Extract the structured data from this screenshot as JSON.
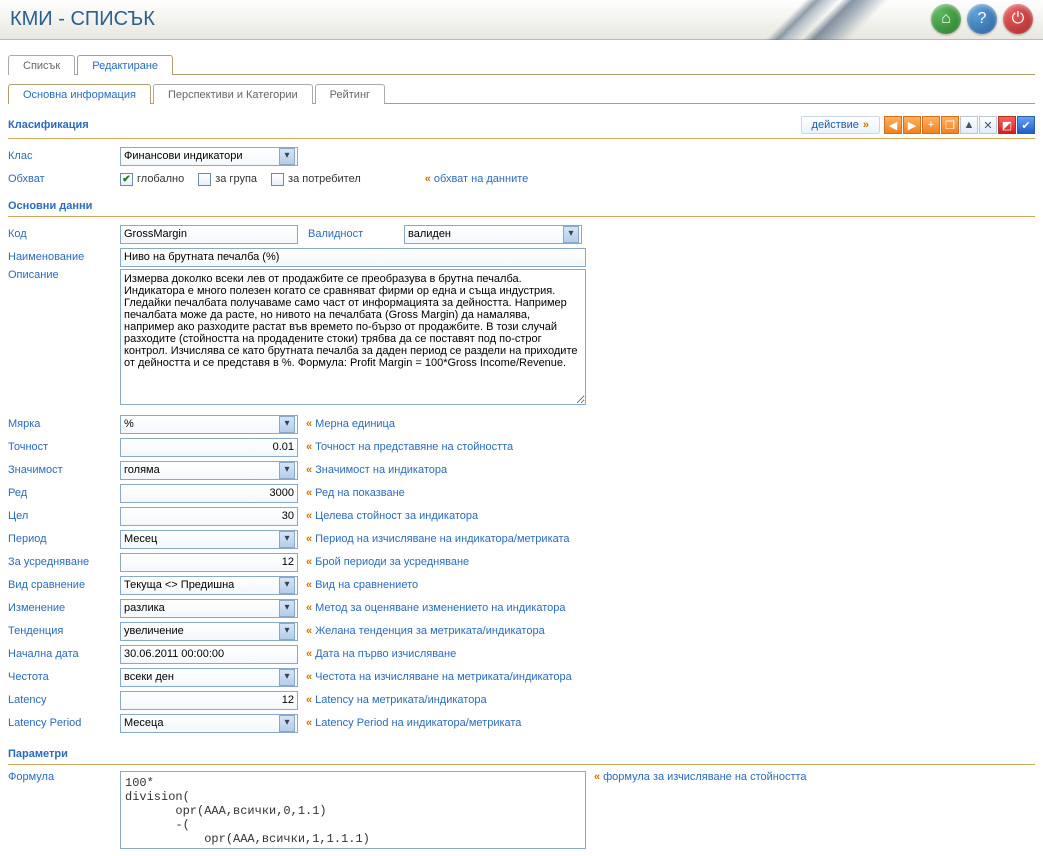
{
  "header": {
    "title": "КМИ - СПИСЪК"
  },
  "tabs": {
    "list": "Списък",
    "edit": "Редактиране"
  },
  "subtabs": {
    "basic": "Основна информация",
    "persp": "Перспективи и Категории",
    "rating": "Рейтинг"
  },
  "action_label": "действие",
  "sections": {
    "classification": "Класификация",
    "basicdata": "Основни данни",
    "parameters": "Параметри"
  },
  "labels": {
    "class": "Клас",
    "scope": "Обхват",
    "global": "глобално",
    "group": "за група",
    "user": "за потребител",
    "scope_hint": "обхват на данните",
    "code": "Код",
    "validity": "Валидност",
    "name": "Наименование",
    "desc": "Описание",
    "measure": "Мярка",
    "precision": "Точност",
    "significance": "Значимост",
    "order": "Ред",
    "target": "Цел",
    "period": "Период",
    "averaging": "За усредняване",
    "compare": "Вид сравнение",
    "change": "Изменение",
    "trend": "Тенденция",
    "startdate": "Начална дата",
    "freq": "Честота",
    "latency": "Latency",
    "latperiod": "Latency Period",
    "formula": "Формула"
  },
  "values": {
    "class": "Финансови индикатори",
    "code": "GrossMargin",
    "validity": "валиден",
    "name": "Ниво на брутната печалба (%)",
    "desc": "Измерва доколко всеки лев от продажбите се преобразува в брутна печалба. Индикатора е много полезен когато се сравняват фирми ор една и съща индустрия. Гледайки печалбата получаваме само част от информацията за дейността. Например печалбата може да расте, но нивото на печалбата (Gross Margin) да намалява, например ако разходите растат във времето по-бързо от продажбите. В този случай разходите (стойността на продадените стоки) трябва да се поставят под по-строг контрол. Изчислява се като брутната печалба за даден период се раздели на приходите от дейността и се представя в %. Формула: Profit Margin = 100*Gross Income/Revenue.",
    "measure": "%",
    "precision": "0.01",
    "significance": "голяма",
    "order": "3000",
    "target": "30",
    "period": "Месец",
    "averaging": "12",
    "compare": "Текуща <> Предишна",
    "change": "разлика",
    "trend": "увеличение",
    "startdate": "30.06.2011 00:00:00",
    "freq": "всеки ден",
    "latency": "12",
    "latperiod": "Месеца",
    "formula": "100*\ndivision(\n       opr(AAA,всички,0,1.1)\n       -(\n           opr(AAA,всички,1,1.1.1)"
  },
  "hints": {
    "measure": "Мерна единица",
    "precision": "Точност на представяне на стойността",
    "significance": "Значимост на индикатора",
    "order": "Ред на показване",
    "target": "Целева стойност за индикатора",
    "period": "Период на изчисляване на индикатора/метриката",
    "averaging": "Брой периоди за усредняване",
    "compare": "Вид на сравнението",
    "change": "Метод за оценяване изменението на индикатора",
    "trend": "Желана тенденция за метриката/индикатора",
    "startdate": "Дата на първо изчисляване",
    "freq": "Честота на изчисляване на метриката/индикатора",
    "latency": "Latency на метриката/индикатора",
    "latperiod": "Latency Period на индикатора/метриката",
    "formula": "формула за изчисляване на стойността"
  },
  "toolbar": {
    "left": "◀",
    "right": "▶",
    "plus": "+",
    "copy": "❐",
    "up": "▲",
    "close": "✕",
    "flag": "◩",
    "check": "✔"
  }
}
